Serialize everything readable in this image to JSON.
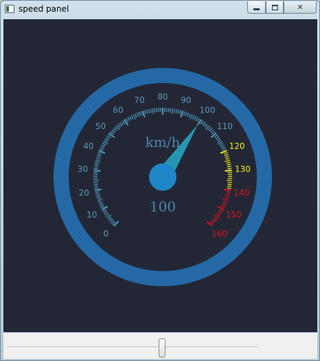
{
  "window": {
    "title": "speed panel",
    "controls": {
      "minimize": "minimize",
      "maximize": "maximize",
      "close": "✕"
    }
  },
  "gauge": {
    "unit": "km/h",
    "value": "100",
    "value_numeric": 100,
    "min": 0,
    "max": 160,
    "major_labels": [
      "0",
      "10",
      "20",
      "30",
      "40",
      "50",
      "60",
      "70",
      "80",
      "90",
      "100",
      "110",
      "120",
      "130",
      "140",
      "150",
      "160"
    ],
    "colors": {
      "background": "#232735",
      "ring": "#2469a6",
      "normal": "#4f9fc2",
      "warning": "#f2ef1e",
      "danger": "#d4151b",
      "needle": "#2696b0",
      "hub": "#1f86c7",
      "unit_text": "#4b86b2"
    },
    "zones": {
      "warning_from": 120,
      "danger_from": 140
    }
  },
  "slider": {
    "value_fraction": 0.62
  },
  "icons": {
    "app": "window-app-icon",
    "close": "close-icon",
    "minimize": "minimize-icon",
    "maximize": "maximize-icon"
  }
}
